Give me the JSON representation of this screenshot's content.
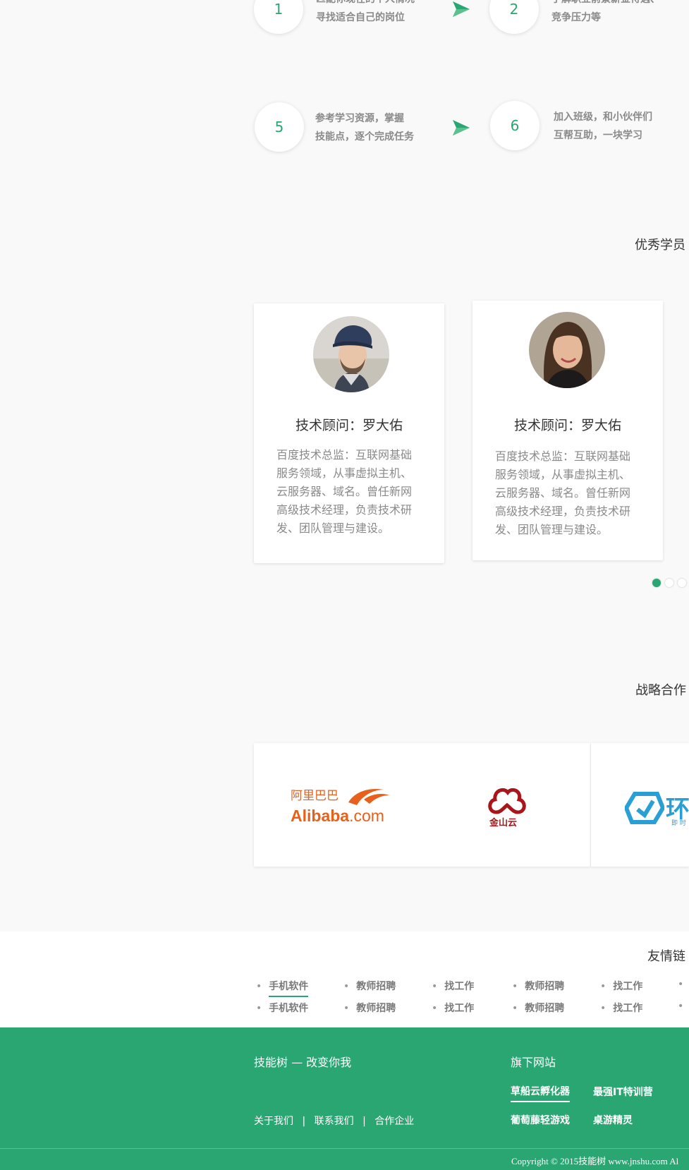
{
  "steps": [
    {
      "number": "1",
      "line1": "匹配你现在的个人情况",
      "line2": "寻找适合自己的岗位"
    },
    {
      "number": "2",
      "line1": "了解职业前景薪金待遇、",
      "line2": "竞争压力等"
    },
    {
      "number": "5",
      "line1": "参考学习资源，掌握",
      "line2": "技能点，逐个完成任务"
    },
    {
      "number": "6",
      "line1": "加入班级，和小伙伴们",
      "line2": "互帮互助，一块学习"
    }
  ],
  "students_section": {
    "title": "优秀学员"
  },
  "cards": [
    {
      "name": "技术顾问：罗大佑",
      "desc": [
        "百度技术总监：互联网基础",
        "服务领域，从事虚拟主机、",
        "云服务器、域名。曾任新网",
        "高级技术经理，负责技术研",
        "发、团队管理与建设。"
      ]
    },
    {
      "name": "技术顾问：罗大佑",
      "desc": [
        "百度技术总监：互联网基础",
        "服务领域，从事虚拟主机、",
        "云服务器、域名。曾任新网",
        "高级技术经理，负责技术研",
        "发、团队管理与建设。"
      ]
    }
  ],
  "carousel": {
    "active_index": 0,
    "count": 3,
    "active_color": "#2aa672"
  },
  "partners_section": {
    "title": "战略合作"
  },
  "partners": [
    {
      "cn": "阿里巴巴",
      "en_main": "Alibaba",
      "en_suffix": ".com",
      "color": "#e8611c"
    },
    {
      "cn": "金山云",
      "color": "#a8161b"
    },
    {
      "cn": "环",
      "sub": "即 时",
      "color": "#2a9fd6"
    }
  ],
  "links_section": {
    "title": "友情链",
    "rows": [
      [
        "手机软件",
        "教师招聘",
        "找工作",
        "教师招聘",
        "找工作"
      ],
      [
        "手机软件",
        "教师招聘",
        "找工作",
        "教师招聘",
        "找工作"
      ]
    ]
  },
  "footer": {
    "slogan": "技能树 — 改变你我",
    "nav": [
      "关于我们",
      "联系我们",
      "合作企业"
    ],
    "nav_sep": "|",
    "sites_title": "旗下网站",
    "sites": [
      "草船云孵化器",
      "最强IT特训营",
      "葡萄藤轻游戏",
      "桌游精灵"
    ],
    "copyright": "Copyright © 2015技能树 www.jnshu.com  Al"
  },
  "colors": {
    "accent": "#2aa672",
    "footer_bg": "#2aa672"
  }
}
